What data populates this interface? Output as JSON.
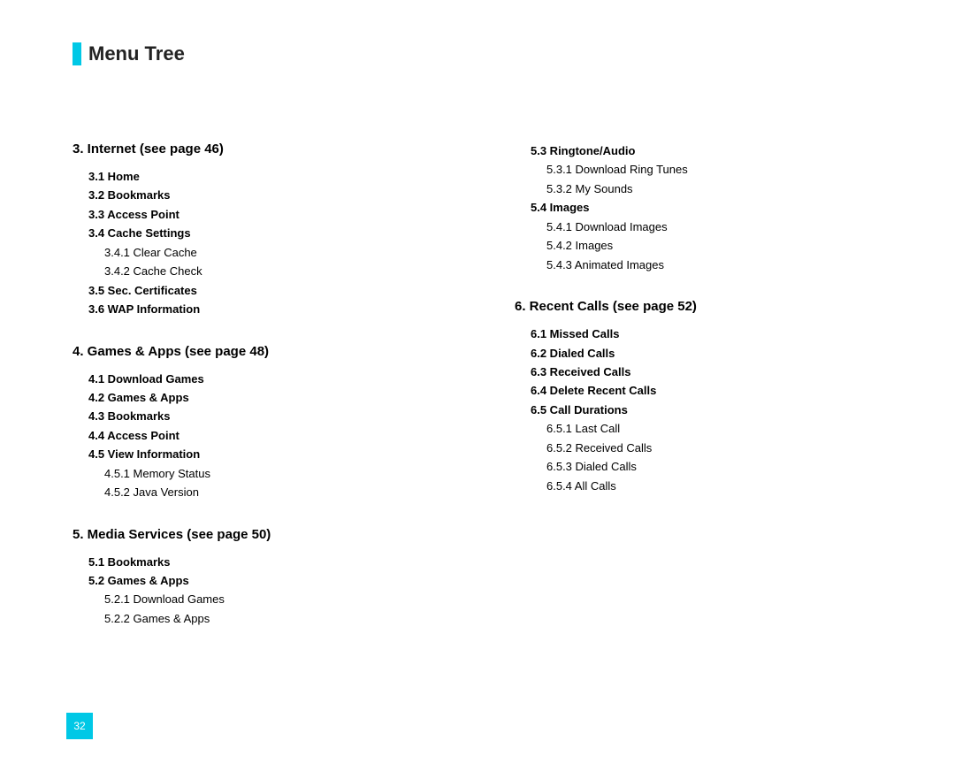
{
  "pageTitle": "Menu Tree",
  "pageNumber": "32",
  "col1": {
    "section3": {
      "head": "3.  Internet (see page 46)",
      "items": [
        {
          "t": "3.1 Home",
          "b": true,
          "l": 1
        },
        {
          "t": "3.2 Bookmarks",
          "b": true,
          "l": 1
        },
        {
          "t": "3.3 Access Point",
          "b": true,
          "l": 1
        },
        {
          "t": "3.4 Cache Settings",
          "b": true,
          "l": 1
        },
        {
          "t": "3.4.1 Clear Cache",
          "b": false,
          "l": 2
        },
        {
          "t": "3.4.2 Cache Check",
          "b": false,
          "l": 2
        },
        {
          "t": "3.5 Sec. Certificates",
          "b": true,
          "l": 1
        },
        {
          "t": "3.6 WAP Information",
          "b": true,
          "l": 1
        }
      ]
    },
    "section4": {
      "head": "4.  Games & Apps (see page 48)",
      "items": [
        {
          "t": "4.1 Download Games",
          "b": true,
          "l": 1
        },
        {
          "t": "4.2 Games & Apps",
          "b": true,
          "l": 1
        },
        {
          "t": "4.3 Bookmarks",
          "b": true,
          "l": 1
        },
        {
          "t": "4.4 Access Point",
          "b": true,
          "l": 1
        },
        {
          "t": "4.5 View Information",
          "b": true,
          "l": 1
        },
        {
          "t": "4.5.1 Memory Status",
          "b": false,
          "l": 2
        },
        {
          "t": "4.5.2 Java Version",
          "b": false,
          "l": 2
        }
      ]
    },
    "section5": {
      "head": "5.  Media Services (see page 50)",
      "items": [
        {
          "t": "5.1 Bookmarks",
          "b": true,
          "l": 1
        },
        {
          "t": "5.2 Games & Apps",
          "b": true,
          "l": 1
        },
        {
          "t": "5.2.1 Download Games",
          "b": false,
          "l": 2
        },
        {
          "t": "5.2.2 Games & Apps",
          "b": false,
          "l": 2
        }
      ]
    }
  },
  "col2": {
    "topItems": [
      {
        "t": "5.3 Ringtone/Audio",
        "b": true,
        "l": 1
      },
      {
        "t": "5.3.1 Download Ring Tunes",
        "b": false,
        "l": 2
      },
      {
        "t": "5.3.2 My Sounds",
        "b": false,
        "l": 2
      },
      {
        "t": "5.4 Images",
        "b": true,
        "l": 1
      },
      {
        "t": "5.4.1 Download Images",
        "b": false,
        "l": 2
      },
      {
        "t": "5.4.2 Images",
        "b": false,
        "l": 2
      },
      {
        "t": "5.4.3 Animated Images",
        "b": false,
        "l": 2
      }
    ],
    "section6": {
      "head": "6.  Recent Calls (see page 52)",
      "items": [
        {
          "t": "6.1 Missed Calls",
          "b": true,
          "l": 1
        },
        {
          "t": "6.2 Dialed Calls",
          "b": true,
          "l": 1
        },
        {
          "t": "6.3 Received Calls",
          "b": true,
          "l": 1
        },
        {
          "t": "6.4 Delete Recent Calls",
          "b": true,
          "l": 1
        },
        {
          "t": "6.5 Call Durations",
          "b": true,
          "l": 1
        },
        {
          "t": "6.5.1 Last Call",
          "b": false,
          "l": 2
        },
        {
          "t": "6.5.2 Received Calls",
          "b": false,
          "l": 2
        },
        {
          "t": "6.5.3 Dialed Calls",
          "b": false,
          "l": 2
        },
        {
          "t": "6.5.4 All Calls",
          "b": false,
          "l": 2
        }
      ]
    }
  }
}
